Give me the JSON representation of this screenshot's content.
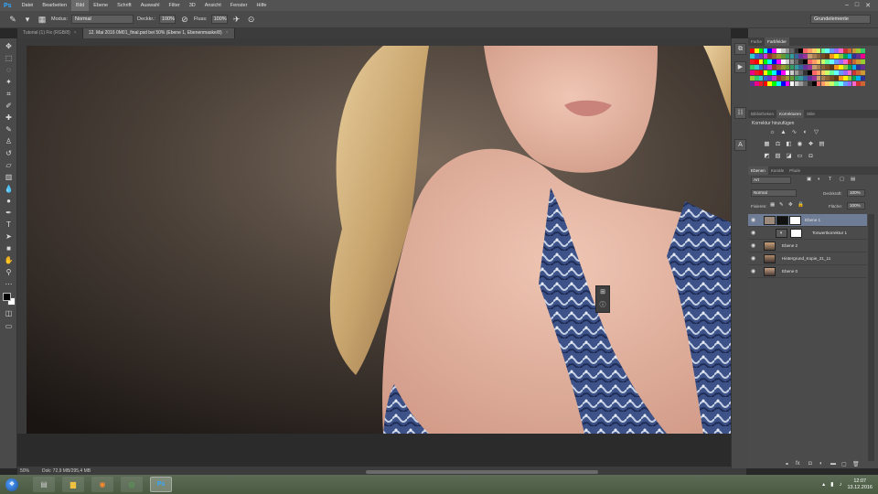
{
  "app": {
    "logo": "Ps"
  },
  "menu": [
    "Datei",
    "Bearbeiten",
    "Bild",
    "Ebene",
    "Schrift",
    "Auswahl",
    "Filter",
    "3D",
    "Ansicht",
    "Fenster",
    "Hilfe"
  ],
  "window_controls": [
    "–",
    "□",
    "✕"
  ],
  "options": {
    "modus_label": "Modus:",
    "modus_value": "Normal",
    "deckkraft_label": "Deckkr.:",
    "deckkraft_value": "100%",
    "fluss_label": "Fluss:",
    "fluss_value": "100%",
    "workspace": "Grundelemente"
  },
  "tabs": [
    {
      "label": "Tutorial (1) Fix (RGB/8)",
      "active": false
    },
    {
      "label": "12. Mai 2016 0M01_final.psd bei 50% (Ebene 1, Ebenenmaske/8)",
      "active": true
    }
  ],
  "panels": {
    "color_tabs": [
      "Farbe",
      "Farbfelder"
    ],
    "adjust_tabs": [
      "Bibliotheken",
      "Korrekturen",
      "Stile"
    ],
    "adjust_title": "Korrektur hinzufügen",
    "layers_tabs": [
      "Ebenen",
      "Kanäle",
      "Pfade"
    ],
    "filter_select": "Art",
    "blend_mode": "Normal",
    "opacity_label": "Deckkraft:",
    "opacity_value": "100%",
    "lock_label": "Fixieren:",
    "fill_label": "Fläche:",
    "fill_value": "100%"
  },
  "layers": [
    {
      "name": "Ebene 1",
      "selected": true,
      "thumb": "mask"
    },
    {
      "name": "Tonwertkorrektur 1",
      "selected": false,
      "thumb": "adjustment"
    },
    {
      "name": "Ebene 2",
      "selected": false,
      "thumb": "photo"
    },
    {
      "name": "Hintergrund_Kopie_21_11",
      "selected": false,
      "thumb": "photo"
    },
    {
      "name": "Ebene 0",
      "selected": false,
      "thumb": "photo"
    }
  ],
  "status": {
    "zoom": "50%",
    "doc_info": "Dok: 72,9 MB/295,4 MB"
  },
  "taskbar": {
    "apps": [
      {
        "name": "explorer",
        "icon": "▤",
        "active": false
      },
      {
        "name": "folder",
        "icon": "▆",
        "active": false
      },
      {
        "name": "firefox",
        "icon": "◉",
        "active": false
      },
      {
        "name": "chrome",
        "icon": "◎",
        "active": false
      },
      {
        "name": "photoshop",
        "icon": "Ps",
        "active": true
      }
    ],
    "time": "12:07",
    "date": "13.12.2016"
  },
  "colors": {
    "accent_selected_layer": "#6e7d95",
    "foreground": "#000000",
    "background": "#ffffff"
  },
  "swatches": [
    "#ff0000",
    "#ffff00",
    "#00ff00",
    "#00ffff",
    "#0000ff",
    "#ff00ff",
    "#ffffff",
    "#cccccc",
    "#999999",
    "#666666",
    "#333333",
    "#000000",
    "#ff6666",
    "#ff9966",
    "#ffcc66",
    "#ccff66",
    "#66ff99",
    "#66ffff",
    "#6699ff",
    "#9966ff",
    "#ff66cc",
    "#cc3333",
    "#cc6633",
    "#cc9933",
    "#99cc33",
    "#33cc66",
    "#33cccc",
    "#3366cc",
    "#6633cc",
    "#cc33cc",
    "#993333",
    "#996633",
    "#999933",
    "#669933",
    "#339966",
    "#339999",
    "#336699",
    "#663399",
    "#993399",
    "#c69c6d",
    "#a67c52",
    "#8c6239",
    "#754c24",
    "#603913",
    "#f7941d",
    "#fff200",
    "#8dc63f",
    "#00a651",
    "#00aeef",
    "#2e3192",
    "#662d91",
    "#ec008c",
    "#ed1c24"
  ]
}
